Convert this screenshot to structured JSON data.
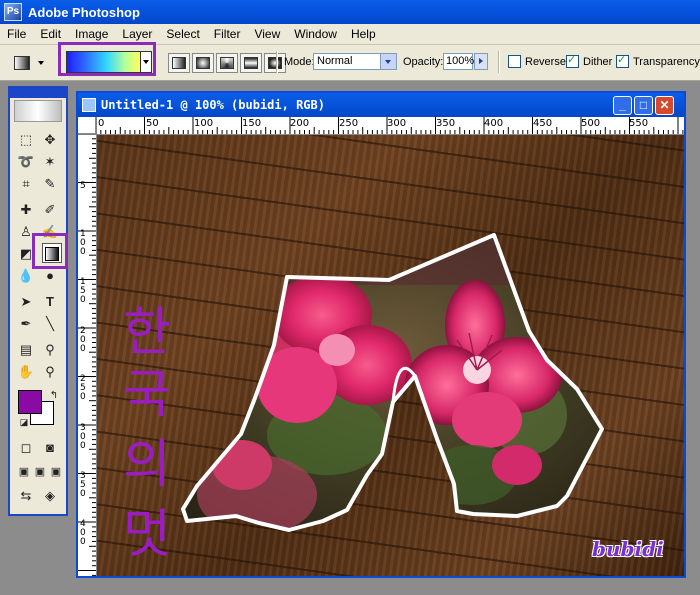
{
  "window": {
    "title": "Adobe Photoshop"
  },
  "menu": [
    "File",
    "Edit",
    "Image",
    "Layer",
    "Select",
    "Filter",
    "View",
    "Window",
    "Help"
  ],
  "options": {
    "mode_label": "Mode:",
    "mode_value": "Normal",
    "opacity_label": "Opacity:",
    "opacity_value": "100%",
    "reverse_label": "Reverse",
    "reverse_checked": false,
    "dither_label": "Dither",
    "dither_checked": true,
    "transparency_label": "Transparency",
    "transparency_checked": true,
    "gradient_colors": [
      "#1e1eff",
      "#34d8ff",
      "#ffff5a"
    ]
  },
  "toolbox": {
    "active_tool": "gradient-tool",
    "foreground_color": "#8b0aa5",
    "background_color": "#ffffff"
  },
  "document": {
    "title": "Untitled-1 @ 100% (bubidi, RGB)",
    "ruler_top": [
      "0",
      "50",
      "100",
      "150",
      "200",
      "250",
      "300",
      "350",
      "400",
      "450",
      "500",
      "550"
    ],
    "ruler_left": [
      "5",
      "1\n0\n0",
      "1\n5\n0",
      "2\n0\n0",
      "2\n5\n0",
      "3\n0\n0",
      "3\n5\n0",
      "4\n0\n0"
    ],
    "canvas_text": [
      "한",
      "국",
      "의",
      "멋"
    ],
    "watermark": "bubidi"
  },
  "highlight_color": "#8a2bbd"
}
